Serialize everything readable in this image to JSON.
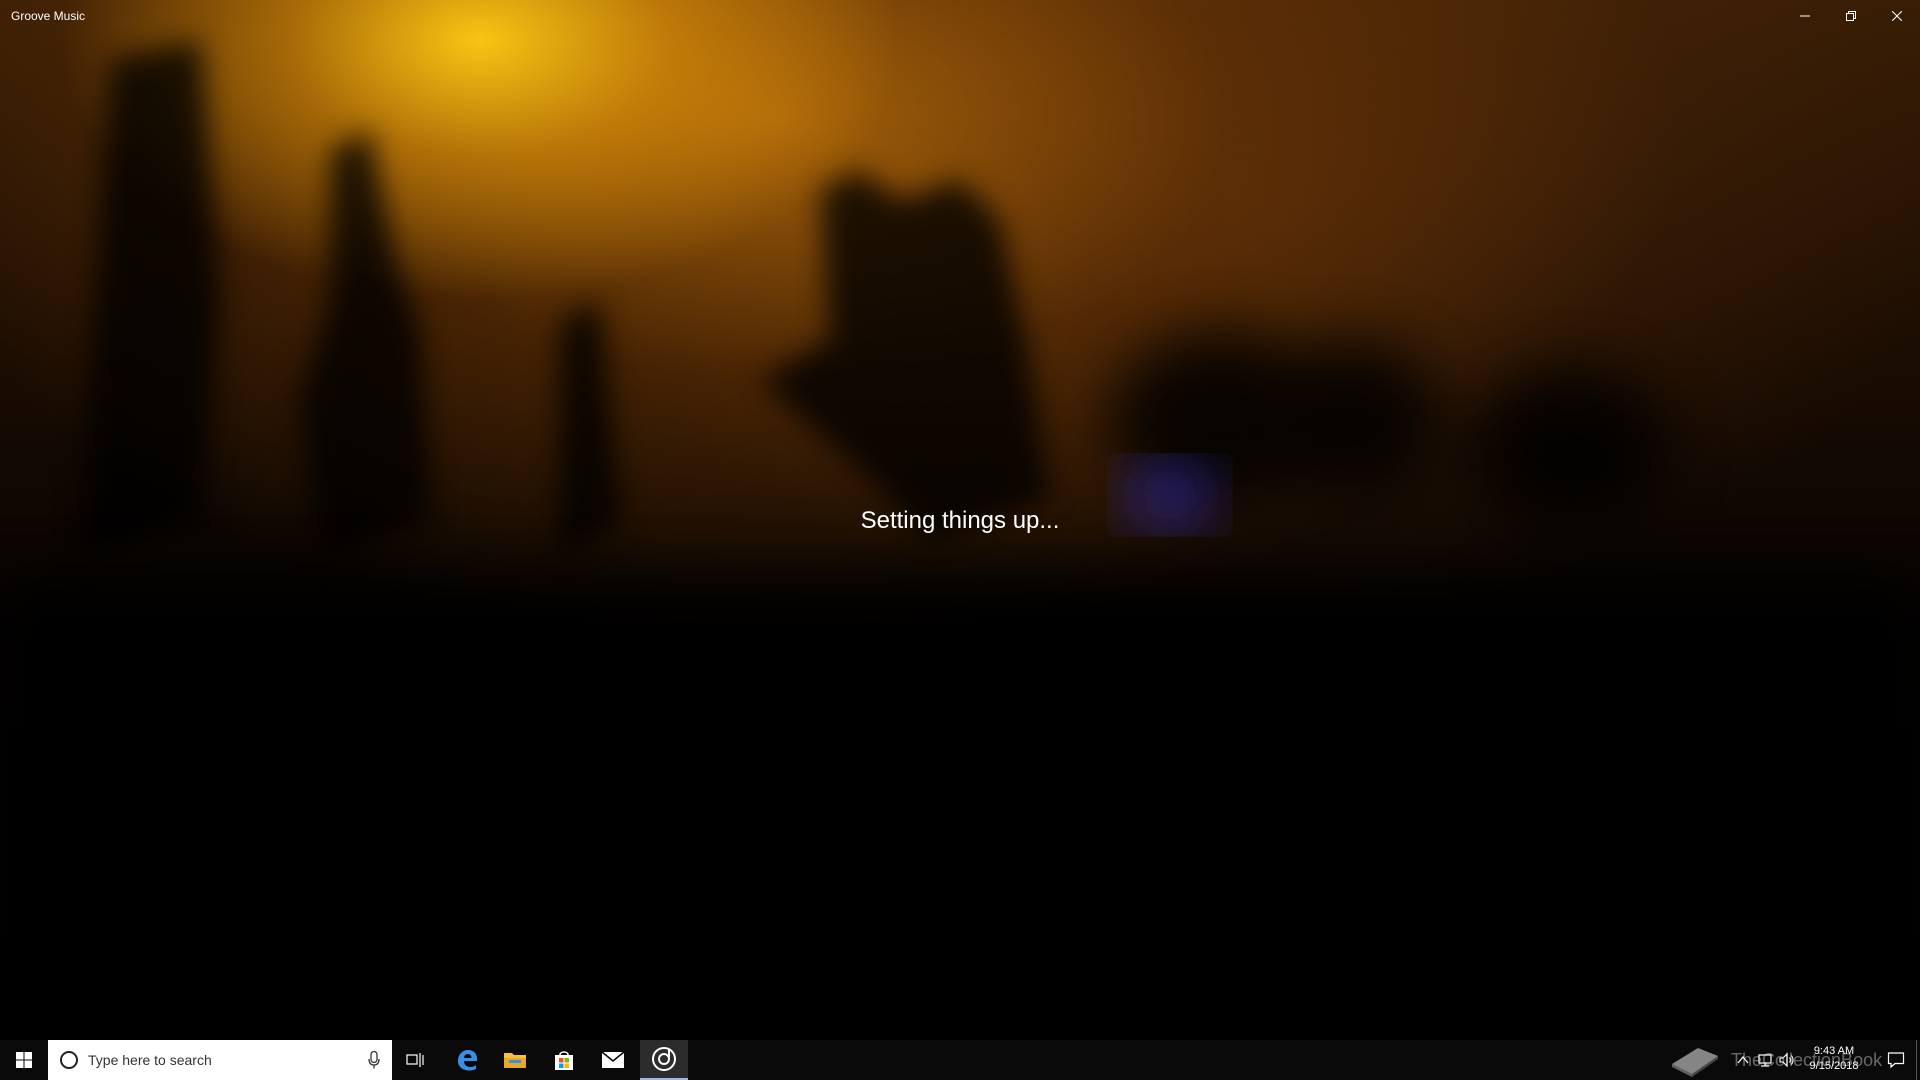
{
  "window": {
    "title": "Groove Music",
    "controls": {
      "minimize_icon": "minimize-icon",
      "restore_icon": "restore-icon",
      "close_icon": "close-icon"
    }
  },
  "main": {
    "status_text": "Setting things up..."
  },
  "taskbar": {
    "search_placeholder": "Type here to search",
    "pinned_apps": [
      {
        "name": "task-view",
        "icon": "task-view-icon"
      },
      {
        "name": "edge",
        "icon": "edge-icon"
      },
      {
        "name": "file-explorer",
        "icon": "folder-icon"
      },
      {
        "name": "store",
        "icon": "store-icon"
      },
      {
        "name": "mail",
        "icon": "mail-icon"
      },
      {
        "name": "groove-music",
        "icon": "groove-icon",
        "active": true
      }
    ],
    "watermark_text": "TheCollectionBook",
    "clock": {
      "time": "9:43 AM",
      "date": "9/15/2018"
    }
  },
  "colors": {
    "glow_yellow": "#ffcd14",
    "glow_orange": "#c8780a",
    "accent_blue": "#3b78d8",
    "taskbar_bg": "#0a0a0a"
  }
}
